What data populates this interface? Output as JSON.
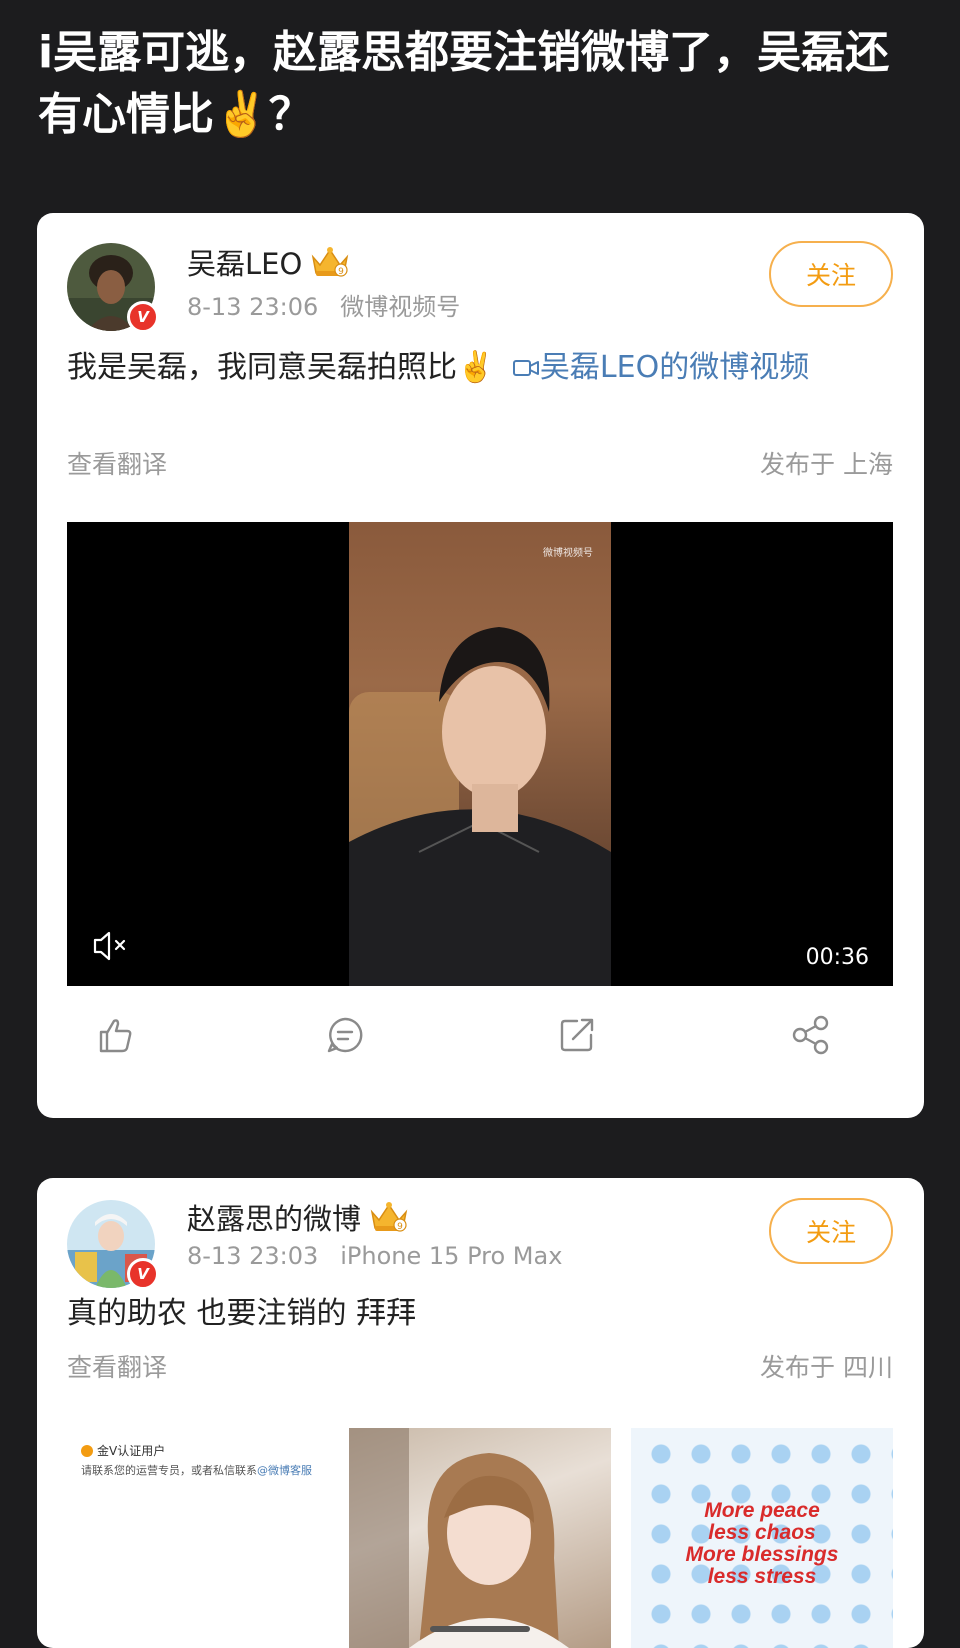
{
  "headline": "i吴露可逃，赵露思都要注销微博了，吴磊还有心情比✌️？",
  "post1": {
    "username": "吴磊LEO",
    "verified_badge": "V",
    "timestamp": "8-13 23:06",
    "source": "微博视频号",
    "follow_label": "关注",
    "text": "我是吴磊，我同意吴磊拍照比✌️",
    "video_link_label": "吴磊LEO的微博视频",
    "translate_label": "查看翻译",
    "location": "发布于 上海",
    "video": {
      "duration": "00:36",
      "watermark": "微博视频号",
      "muted": true
    },
    "actions": [
      "like-icon",
      "comment-icon",
      "repost-icon",
      "share-icon"
    ]
  },
  "post2": {
    "username": "赵露思的微博",
    "verified_badge": "V",
    "timestamp": "8-13 23:03",
    "source": "iPhone 15 Pro Max",
    "follow_label": "关注",
    "text": "真的助农 也要注销的 拜拜",
    "translate_label": "查看翻译",
    "location": "发布于 四川",
    "images": {
      "notice_badge": "金V认证用户",
      "notice_text": "请联系您的运营专员，或者私信联系",
      "notice_link": "@微博客服",
      "motto_lines": [
        "More peace",
        "less chaos",
        "More blessings",
        "less stress"
      ]
    }
  },
  "colors": {
    "background": "#1c1c1e",
    "follow_accent": "#f39c12",
    "link_blue": "#4a7db5",
    "verified_red": "#e8332a"
  }
}
